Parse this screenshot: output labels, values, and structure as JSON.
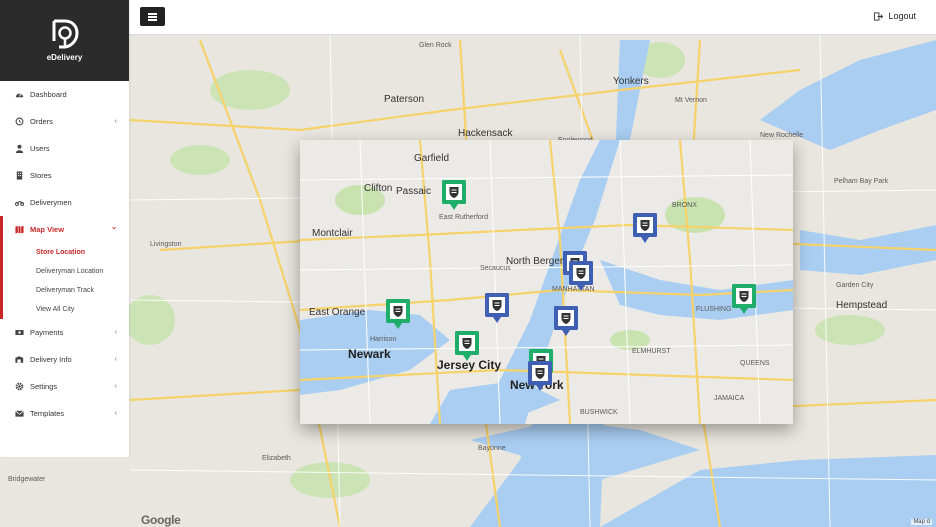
{
  "brand": {
    "name": "eDelivery"
  },
  "topbar": {
    "logout_label": "Logout"
  },
  "sidebar": {
    "items": [
      {
        "label": "Dashboard",
        "icon": "dashboard-icon"
      },
      {
        "label": "Orders",
        "icon": "history-icon",
        "has_children": true
      },
      {
        "label": "Users",
        "icon": "user-icon"
      },
      {
        "label": "Stores",
        "icon": "building-icon"
      },
      {
        "label": "Deliverymen",
        "icon": "motorcycle-icon"
      },
      {
        "label": "Map View",
        "icon": "map-icon",
        "active": true,
        "expanded": true
      },
      {
        "label": "Payments",
        "icon": "money-icon",
        "has_children": true
      },
      {
        "label": "Delivery Info",
        "icon": "info-icon",
        "has_children": true
      },
      {
        "label": "Settings",
        "icon": "gear-icon",
        "has_children": true
      },
      {
        "label": "Templates",
        "icon": "envelope-icon",
        "has_children": true
      }
    ],
    "map_view_children": [
      {
        "label": "Store Location",
        "active": true
      },
      {
        "label": "Deliveryman Location"
      },
      {
        "label": "Deliveryman Track"
      },
      {
        "label": "View All City"
      }
    ]
  },
  "map": {
    "attribution_logo": "Google",
    "map_data_label": "Map d",
    "labels": {
      "glen_rock": "Glen Rock",
      "paterson": "Paterson",
      "hackensack": "Hackensack",
      "englewood": "Englewood",
      "yonkers": "Yonkers",
      "mt_vernon": "Mt Vernon",
      "new_rochelle": "New Rochelle",
      "clifton": "Clifton",
      "passaic": "Passaic",
      "garfield": "Garfield",
      "east_rutherford": "East Rutherford",
      "montclair": "Montclair",
      "north_bergen": "North Bergen",
      "manhattan": "MANHATTAN",
      "east_orange": "East Orange",
      "newark": "Newark",
      "harrison": "Harrison",
      "jersey_city": "Jersey City",
      "new_york": "New York",
      "queens": "QUEENS",
      "flushing": "FLUSHING",
      "bronx": "BRONX",
      "pelham_bay_park": "Pelham Bay Park",
      "hempstead": "Hempstead",
      "garden_city": "Garden City",
      "bayonne": "Bayonne",
      "elizabeth": "Elizabeth",
      "livingston": "Livingston",
      "bridgewater": "Bridgewater",
      "secaucus": "Secaucus",
      "jamaica": "JAMAICA",
      "elmhurst": "ELMHURST",
      "bushwick": "BUSHWICK"
    },
    "pins": [
      {
        "type": "store",
        "color": "#1fae6a"
      },
      {
        "type": "store",
        "color": "#1fae6a"
      },
      {
        "type": "store",
        "color": "#1fae6a"
      },
      {
        "type": "store",
        "color": "#1fae6a"
      },
      {
        "type": "store",
        "color": "#1fae6a"
      },
      {
        "type": "deliveryman",
        "color": "#3f5fb3"
      },
      {
        "type": "deliveryman",
        "color": "#3f5fb3"
      },
      {
        "type": "deliveryman",
        "color": "#3f5fb3"
      },
      {
        "type": "deliveryman",
        "color": "#3f5fb3"
      },
      {
        "type": "deliveryman",
        "color": "#3f5fb3"
      },
      {
        "type": "deliveryman",
        "color": "#3f5fb3"
      }
    ]
  },
  "colors": {
    "accent": "#c62828",
    "brand_bg": "#2b2b2b",
    "water": "#a7cdf2",
    "park": "#c8e6b4",
    "road": "#f7d56b"
  }
}
